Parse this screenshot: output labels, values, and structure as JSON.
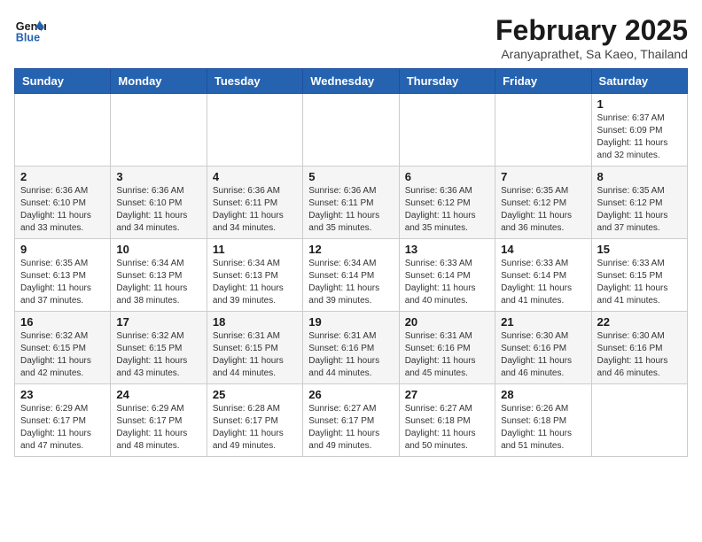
{
  "header": {
    "logo_line1": "General",
    "logo_line2": "Blue",
    "month_year": "February 2025",
    "location": "Aranyaprathet, Sa Kaeo, Thailand"
  },
  "weekdays": [
    "Sunday",
    "Monday",
    "Tuesday",
    "Wednesday",
    "Thursday",
    "Friday",
    "Saturday"
  ],
  "weeks": [
    [
      {
        "day": "",
        "sunrise": "",
        "sunset": "",
        "daylight": ""
      },
      {
        "day": "",
        "sunrise": "",
        "sunset": "",
        "daylight": ""
      },
      {
        "day": "",
        "sunrise": "",
        "sunset": "",
        "daylight": ""
      },
      {
        "day": "",
        "sunrise": "",
        "sunset": "",
        "daylight": ""
      },
      {
        "day": "",
        "sunrise": "",
        "sunset": "",
        "daylight": ""
      },
      {
        "day": "",
        "sunrise": "",
        "sunset": "",
        "daylight": ""
      },
      {
        "day": "1",
        "sunrise": "Sunrise: 6:37 AM",
        "sunset": "Sunset: 6:09 PM",
        "daylight": "Daylight: 11 hours and 32 minutes."
      }
    ],
    [
      {
        "day": "2",
        "sunrise": "Sunrise: 6:36 AM",
        "sunset": "Sunset: 6:10 PM",
        "daylight": "Daylight: 11 hours and 33 minutes."
      },
      {
        "day": "3",
        "sunrise": "Sunrise: 6:36 AM",
        "sunset": "Sunset: 6:10 PM",
        "daylight": "Daylight: 11 hours and 34 minutes."
      },
      {
        "day": "4",
        "sunrise": "Sunrise: 6:36 AM",
        "sunset": "Sunset: 6:11 PM",
        "daylight": "Daylight: 11 hours and 34 minutes."
      },
      {
        "day": "5",
        "sunrise": "Sunrise: 6:36 AM",
        "sunset": "Sunset: 6:11 PM",
        "daylight": "Daylight: 11 hours and 35 minutes."
      },
      {
        "day": "6",
        "sunrise": "Sunrise: 6:36 AM",
        "sunset": "Sunset: 6:12 PM",
        "daylight": "Daylight: 11 hours and 35 minutes."
      },
      {
        "day": "7",
        "sunrise": "Sunrise: 6:35 AM",
        "sunset": "Sunset: 6:12 PM",
        "daylight": "Daylight: 11 hours and 36 minutes."
      },
      {
        "day": "8",
        "sunrise": "Sunrise: 6:35 AM",
        "sunset": "Sunset: 6:12 PM",
        "daylight": "Daylight: 11 hours and 37 minutes."
      }
    ],
    [
      {
        "day": "9",
        "sunrise": "Sunrise: 6:35 AM",
        "sunset": "Sunset: 6:13 PM",
        "daylight": "Daylight: 11 hours and 37 minutes."
      },
      {
        "day": "10",
        "sunrise": "Sunrise: 6:34 AM",
        "sunset": "Sunset: 6:13 PM",
        "daylight": "Daylight: 11 hours and 38 minutes."
      },
      {
        "day": "11",
        "sunrise": "Sunrise: 6:34 AM",
        "sunset": "Sunset: 6:13 PM",
        "daylight": "Daylight: 11 hours and 39 minutes."
      },
      {
        "day": "12",
        "sunrise": "Sunrise: 6:34 AM",
        "sunset": "Sunset: 6:14 PM",
        "daylight": "Daylight: 11 hours and 39 minutes."
      },
      {
        "day": "13",
        "sunrise": "Sunrise: 6:33 AM",
        "sunset": "Sunset: 6:14 PM",
        "daylight": "Daylight: 11 hours and 40 minutes."
      },
      {
        "day": "14",
        "sunrise": "Sunrise: 6:33 AM",
        "sunset": "Sunset: 6:14 PM",
        "daylight": "Daylight: 11 hours and 41 minutes."
      },
      {
        "day": "15",
        "sunrise": "Sunrise: 6:33 AM",
        "sunset": "Sunset: 6:15 PM",
        "daylight": "Daylight: 11 hours and 41 minutes."
      }
    ],
    [
      {
        "day": "16",
        "sunrise": "Sunrise: 6:32 AM",
        "sunset": "Sunset: 6:15 PM",
        "daylight": "Daylight: 11 hours and 42 minutes."
      },
      {
        "day": "17",
        "sunrise": "Sunrise: 6:32 AM",
        "sunset": "Sunset: 6:15 PM",
        "daylight": "Daylight: 11 hours and 43 minutes."
      },
      {
        "day": "18",
        "sunrise": "Sunrise: 6:31 AM",
        "sunset": "Sunset: 6:15 PM",
        "daylight": "Daylight: 11 hours and 44 minutes."
      },
      {
        "day": "19",
        "sunrise": "Sunrise: 6:31 AM",
        "sunset": "Sunset: 6:16 PM",
        "daylight": "Daylight: 11 hours and 44 minutes."
      },
      {
        "day": "20",
        "sunrise": "Sunrise: 6:31 AM",
        "sunset": "Sunset: 6:16 PM",
        "daylight": "Daylight: 11 hours and 45 minutes."
      },
      {
        "day": "21",
        "sunrise": "Sunrise: 6:30 AM",
        "sunset": "Sunset: 6:16 PM",
        "daylight": "Daylight: 11 hours and 46 minutes."
      },
      {
        "day": "22",
        "sunrise": "Sunrise: 6:30 AM",
        "sunset": "Sunset: 6:16 PM",
        "daylight": "Daylight: 11 hours and 46 minutes."
      }
    ],
    [
      {
        "day": "23",
        "sunrise": "Sunrise: 6:29 AM",
        "sunset": "Sunset: 6:17 PM",
        "daylight": "Daylight: 11 hours and 47 minutes."
      },
      {
        "day": "24",
        "sunrise": "Sunrise: 6:29 AM",
        "sunset": "Sunset: 6:17 PM",
        "daylight": "Daylight: 11 hours and 48 minutes."
      },
      {
        "day": "25",
        "sunrise": "Sunrise: 6:28 AM",
        "sunset": "Sunset: 6:17 PM",
        "daylight": "Daylight: 11 hours and 49 minutes."
      },
      {
        "day": "26",
        "sunrise": "Sunrise: 6:27 AM",
        "sunset": "Sunset: 6:17 PM",
        "daylight": "Daylight: 11 hours and 49 minutes."
      },
      {
        "day": "27",
        "sunrise": "Sunrise: 6:27 AM",
        "sunset": "Sunset: 6:18 PM",
        "daylight": "Daylight: 11 hours and 50 minutes."
      },
      {
        "day": "28",
        "sunrise": "Sunrise: 6:26 AM",
        "sunset": "Sunset: 6:18 PM",
        "daylight": "Daylight: 11 hours and 51 minutes."
      },
      {
        "day": "",
        "sunrise": "",
        "sunset": "",
        "daylight": ""
      }
    ]
  ]
}
